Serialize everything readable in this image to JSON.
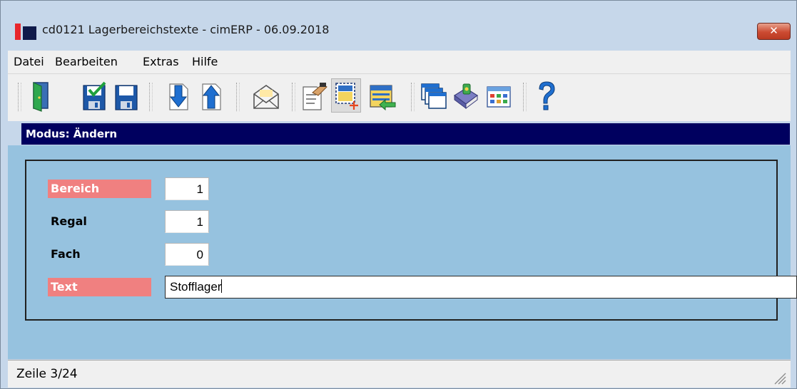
{
  "window": {
    "title": "cd0121 Lagerbereichstexte - cimERP - 06.09.2018",
    "close_label": "✕"
  },
  "menu": [
    "Datei",
    "Bearbeiten",
    "Extras",
    "Hilfe"
  ],
  "toolbar": {
    "buttons": [
      "exit-door-icon",
      "save-check-icon",
      "save-icon",
      "record-down-icon",
      "record-up-icon",
      "mail-icon",
      "edit-hand-icon",
      "selection-add-icon",
      "list-import-icon",
      "windows-icon",
      "book-icon",
      "grid-icon",
      "help-icon"
    ],
    "active": "selection-add-icon"
  },
  "mode": "Modus: Ändern",
  "form": {
    "bereich_label": "Bereich",
    "bereich_value": "1",
    "regal_label": "Regal",
    "regal_value": "1",
    "fach_label": "Fach",
    "fach_value": "0",
    "text_label": "Text",
    "text_value": "Stofflager"
  },
  "status": "Zeile 3/24",
  "colors": {
    "mode_bar": "#00005f",
    "form_bg": "#96c2df",
    "required_label": "#f08080"
  }
}
